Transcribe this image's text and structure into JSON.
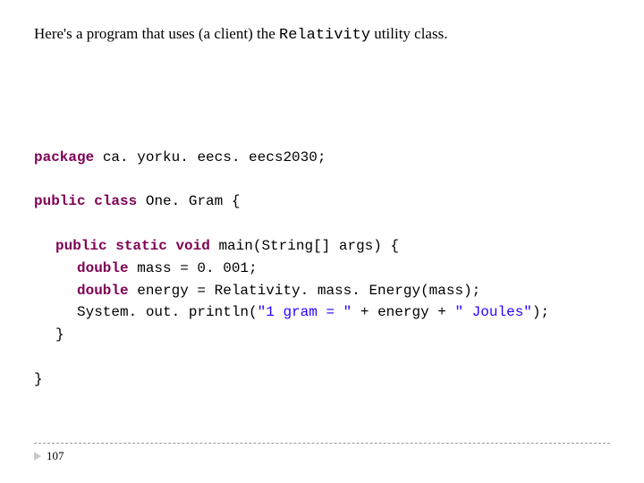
{
  "heading": {
    "pre": "Here's a program that uses (a client) the ",
    "classname": "Relativity",
    "post": " utility class."
  },
  "code": {
    "kw_package": "package",
    "pkg": " ca. yorku. eecs. eecs2030;",
    "kw_public1": "public",
    "kw_class": "class",
    "classname": " One. Gram {",
    "kw_public2": "public",
    "kw_static": "static",
    "kw_void": "void",
    "main_sig": " main(String[] args) {",
    "kw_double1": "double",
    "mass_line": " mass = 0. 001;",
    "kw_double2": "double",
    "energy_line": " energy = Relativity. mass. Energy(mass);",
    "println_pre": "System. out. println(",
    "str1": "\"1 gram = \"",
    "plus1": " + energy + ",
    "str2": "\" Joules\"",
    "println_post": ");",
    "close_inner": "}",
    "close_outer": "}"
  },
  "page": {
    "number": "107"
  }
}
